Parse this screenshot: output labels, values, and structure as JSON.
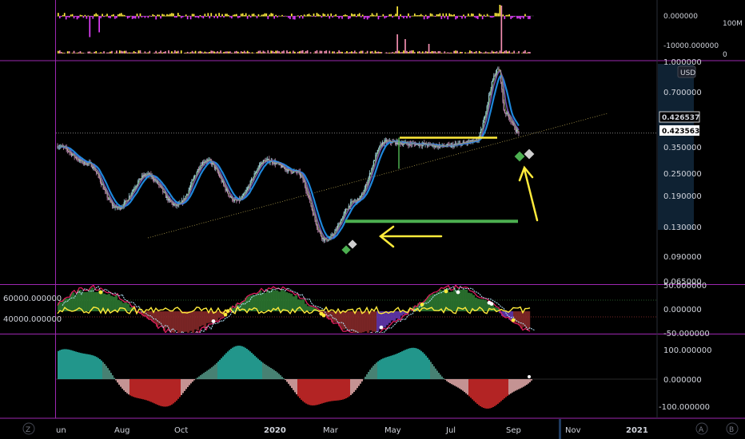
{
  "chart_data": {
    "type": "candlestick",
    "currency": "USD",
    "time_axis": [
      "un",
      "Aug",
      "Oct",
      "2020",
      "Mar",
      "May",
      "Jul",
      "Sep",
      "Nov",
      "2021"
    ],
    "price_axis": [
      "1.000000",
      "0.700000",
      "0.350000",
      "0.250000",
      "0.190000",
      "0.130000",
      "0.090000",
      "0.065000"
    ],
    "price_scale": "log",
    "price_markers": [
      "0.426537",
      "0.423563"
    ],
    "last_price": 0.4236,
    "price_path": [
      [
        "2019-06",
        0.36
      ],
      [
        "2019-07",
        0.29
      ],
      [
        "2019-08",
        0.165
      ],
      [
        "2019-09",
        0.25
      ],
      [
        "2019-10",
        0.17
      ],
      [
        "2019-11",
        0.3
      ],
      [
        "2019-12",
        0.18
      ],
      [
        "2020-01",
        0.3
      ],
      [
        "2020-02",
        0.26
      ],
      [
        "2020-03",
        0.11
      ],
      [
        "2020-04",
        0.18
      ],
      [
        "2020-05",
        0.38
      ],
      [
        "2020-06",
        0.37
      ],
      [
        "2020-07",
        0.36
      ],
      [
        "2020-08",
        0.38
      ],
      [
        "2020-08-25",
        0.95
      ],
      [
        "2020-09",
        0.55
      ],
      [
        "2020-09-15",
        0.43
      ]
    ],
    "support_level": 0.135,
    "resistance_level": 0.4,
    "volume_panel": {
      "axis": [
        "100M",
        "0"
      ],
      "delta_axis": [
        "0.000000",
        "-10000.000000"
      ]
    },
    "oscillator_panel": {
      "axis": [
        "50.000000",
        "0.000000",
        "-50.000000"
      ],
      "left_axis": [
        "60000.000000",
        "40000.000000"
      ]
    },
    "momentum_panel": {
      "axis": [
        "100.000000",
        "0.000000",
        "-100.000000"
      ]
    },
    "colors": {
      "up": "#26a69a",
      "down": "#ef5350",
      "ribbon_fast": "#7e57c2",
      "ribbon_slow": "#2196f3",
      "annotation": "#ffeb3b",
      "support": "#4caf50",
      "divider": "#9c27b0"
    }
  },
  "ui": {
    "left_badge": "Z",
    "right_badge_a": "A",
    "right_badge_b": "B"
  }
}
